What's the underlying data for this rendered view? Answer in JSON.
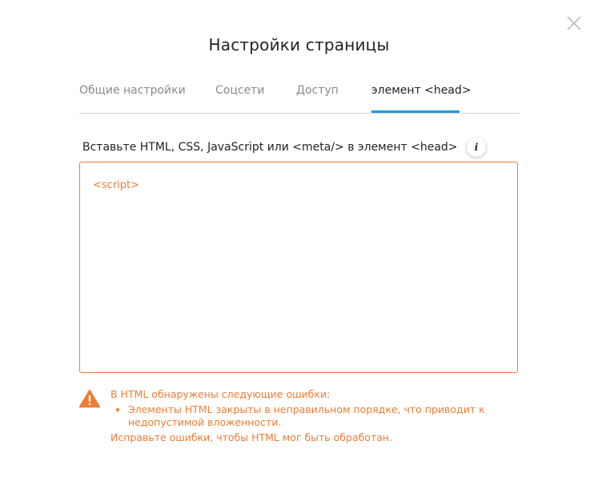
{
  "dialog": {
    "title": "Настройки страницы",
    "close_icon": "close-icon"
  },
  "tabs": [
    {
      "label": "Общие настройки",
      "active": false
    },
    {
      "label": "Соцсети",
      "active": false
    },
    {
      "label": "Доступ",
      "active": false
    },
    {
      "label": "элемент <head>",
      "active": true
    }
  ],
  "head_editor": {
    "label": "Вставьте HTML, CSS, JavaScript или <meta/> в элемент <head>",
    "info_icon": "info-icon",
    "info_glyph": "i",
    "value": "<script>"
  },
  "error": {
    "icon": "warning-icon",
    "heading": "В HTML обнаружены следующие ошибки:",
    "items": [
      "Элементы HTML закрыты в неправильном порядке, что приводит к недопустимой вложенности."
    ],
    "footer": "Исправьте ошибки, чтобы HTML мог быть обработан."
  },
  "colors": {
    "accent_tab": "#1e9bd7",
    "error": "#f07c33",
    "text": "#222222",
    "muted": "#8a8a8a"
  }
}
